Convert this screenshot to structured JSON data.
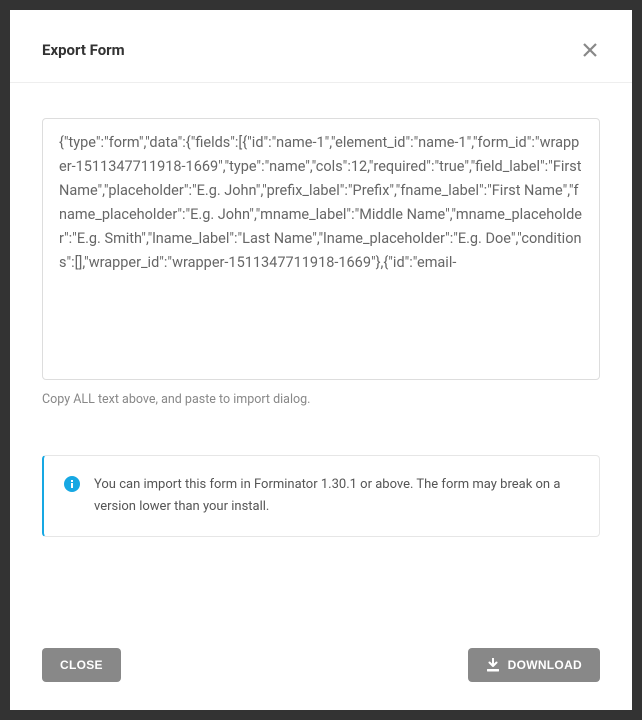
{
  "header": {
    "title": "Export Form"
  },
  "body": {
    "export_content": "{\"type\":\"form\",\"data\":{\"fields\":[{\"id\":\"name-1\",\"element_id\":\"name-1\",\"form_id\":\"wrapper-1511347711918-1669\",\"type\":\"name\",\"cols\":12,\"required\":\"true\",\"field_label\":\"First Name\",\"placeholder\":\"E.g. John\",\"prefix_label\":\"Prefix\",\"fname_label\":\"First Name\",\"fname_placeholder\":\"E.g. John\",\"mname_label\":\"Middle Name\",\"mname_placeholder\":\"E.g. Smith\",\"lname_label\":\"Last Name\",\"lname_placeholder\":\"E.g. Doe\",\"conditions\":[],\"wrapper_id\":\"wrapper-1511347711918-1669\"},{\"id\":\"email-",
    "helper_text": "Copy ALL text above, and paste to import dialog.",
    "notice_text": "You can import this form in Forminator 1.30.1 or above. The form may break on a version lower than your install."
  },
  "footer": {
    "close_label": "CLOSE",
    "download_label": "DOWNLOAD"
  },
  "icons": {
    "close": "close-icon",
    "info": "info-icon",
    "download": "download-icon"
  }
}
